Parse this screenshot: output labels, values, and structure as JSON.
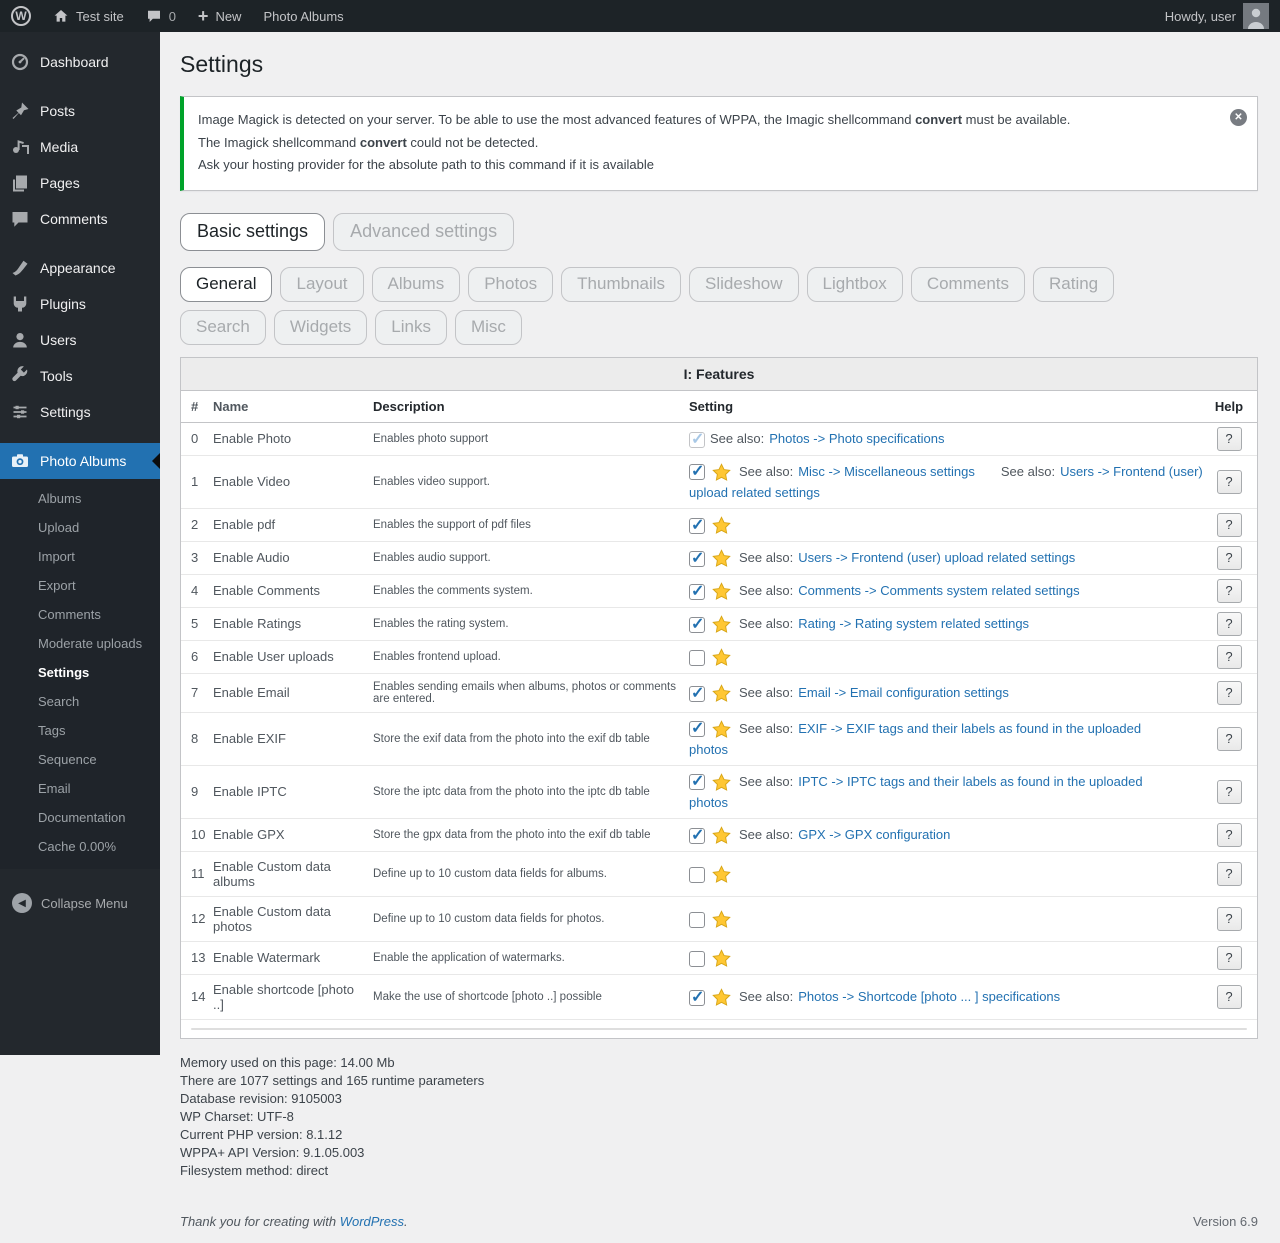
{
  "colors": {
    "accent_blue": "#2271b1",
    "notice_green": "#00a32a",
    "star_gold": "#ffc733",
    "adminbar_bg": "#1d2327",
    "sidebar_bg": "#23282d",
    "page_bg": "#f0f0f1",
    "link_blue": "#2271b1"
  },
  "admin_bar": {
    "site_name": "Test site",
    "comment_count": "0",
    "new_label": "New",
    "photo_albums_label": "Photo Albums",
    "howdy": "Howdy, user"
  },
  "sidebar": {
    "items": [
      {
        "label": "Dashboard",
        "icon": "dashboard-icon"
      },
      {
        "label": "Posts",
        "icon": "pushpin-icon",
        "gap": true
      },
      {
        "label": "Media",
        "icon": "media-icon"
      },
      {
        "label": "Pages",
        "icon": "pages-icon"
      },
      {
        "label": "Comments",
        "icon": "comment-bubble-icon"
      },
      {
        "label": "Appearance",
        "icon": "brush-icon",
        "gap": true
      },
      {
        "label": "Plugins",
        "icon": "plugin-icon"
      },
      {
        "label": "Users",
        "icon": "user-icon"
      },
      {
        "label": "Tools",
        "icon": "wrench-icon"
      },
      {
        "label": "Settings",
        "icon": "sliders-icon"
      },
      {
        "label": "Photo Albums",
        "icon": "camera-icon",
        "active": true,
        "gap": true
      }
    ],
    "submenu": [
      {
        "label": "Albums"
      },
      {
        "label": "Upload"
      },
      {
        "label": "Import"
      },
      {
        "label": "Export"
      },
      {
        "label": "Comments"
      },
      {
        "label": "Moderate uploads"
      },
      {
        "label": "Settings",
        "active": true
      },
      {
        "label": "Search"
      },
      {
        "label": "Tags"
      },
      {
        "label": "Sequence"
      },
      {
        "label": "Email"
      },
      {
        "label": "Documentation"
      },
      {
        "label": "Cache 0.00%"
      }
    ],
    "collapse_label": "Collapse Menu"
  },
  "page": {
    "title": "Settings",
    "notice": {
      "line1_pre": "Image Magick is detected on your server. To be able to use the most advanced features of WPPA, the Imagic shellcommand ",
      "line1_bold": "convert",
      "line1_post": " must be available.",
      "line2_pre": "The Imagick shellcommand ",
      "line2_bold": "convert",
      "line2_post": " could not be detected.",
      "line3": "Ask your hosting provider for the absolute path to this command if it is available"
    },
    "primary_tabs": [
      {
        "label": "Basic settings",
        "active": true
      },
      {
        "label": "Advanced settings"
      }
    ],
    "section_tabs": [
      {
        "label": "General",
        "active": true
      },
      {
        "label": "Layout"
      },
      {
        "label": "Albums"
      },
      {
        "label": "Photos"
      },
      {
        "label": "Thumbnails"
      },
      {
        "label": "Slideshow"
      },
      {
        "label": "Lightbox"
      },
      {
        "label": "Comments"
      },
      {
        "label": "Rating"
      },
      {
        "label": "Search"
      },
      {
        "label": "Widgets"
      },
      {
        "label": "Links"
      },
      {
        "label": "Misc"
      }
    ]
  },
  "table": {
    "title": "I: Features",
    "columns": [
      "#",
      "Name",
      "Description",
      "Setting",
      "Help"
    ],
    "see_also_label": "See also:",
    "help_label": "?",
    "rows": [
      {
        "num": "0",
        "name": "Enable Photo",
        "desc": "Enables photo support",
        "check": "disabled",
        "star": false,
        "see_also": [
          "Photos -> Photo specifications"
        ]
      },
      {
        "num": "1",
        "name": "Enable Video",
        "desc": "Enables video support.",
        "check": "on",
        "star": true,
        "see_also": [
          "Misc -> Miscellaneous settings",
          "Users -> Frontend (user) upload related settings"
        ]
      },
      {
        "num": "2",
        "name": "Enable pdf",
        "desc": "Enables the support of pdf files",
        "check": "on",
        "star": true,
        "see_also": []
      },
      {
        "num": "3",
        "name": "Enable Audio",
        "desc": "Enables audio support.",
        "check": "on",
        "star": true,
        "see_also": [
          "Users -> Frontend (user) upload related settings"
        ]
      },
      {
        "num": "4",
        "name": "Enable Comments",
        "desc": "Enables the comments system.",
        "check": "on",
        "star": true,
        "see_also": [
          "Comments -> Comments system related settings"
        ]
      },
      {
        "num": "5",
        "name": "Enable Ratings",
        "desc": "Enables the rating system.",
        "check": "on",
        "star": true,
        "see_also": [
          "Rating -> Rating system related settings"
        ]
      },
      {
        "num": "6",
        "name": "Enable User uploads",
        "desc": "Enables frontend upload.",
        "check": "off",
        "star": true,
        "see_also": []
      },
      {
        "num": "7",
        "name": "Enable Email",
        "desc": "Enables sending emails when albums, photos or comments are entered.",
        "check": "on",
        "star": true,
        "see_also": [
          "Email -> Email configuration settings"
        ]
      },
      {
        "num": "8",
        "name": "Enable EXIF",
        "desc": "Store the exif data from the photo into the exif db table",
        "check": "on",
        "star": true,
        "see_also": [
          "EXIF -> EXIF tags and their labels as found in the uploaded photos"
        ]
      },
      {
        "num": "9",
        "name": "Enable IPTC",
        "desc": "Store the iptc data from the photo into the iptc db table",
        "check": "on",
        "star": true,
        "see_also": [
          "IPTC -> IPTC tags and their labels as found in the uploaded photos"
        ]
      },
      {
        "num": "10",
        "name": "Enable GPX",
        "desc": "Store the gpx data from the photo into the exif db table",
        "check": "on",
        "star": true,
        "see_also": [
          "GPX -> GPX configuration"
        ]
      },
      {
        "num": "11",
        "name": "Enable Custom data albums",
        "desc": "Define up to 10 custom data fields for albums.",
        "check": "off",
        "star": true,
        "see_also": []
      },
      {
        "num": "12",
        "name": "Enable Custom data photos",
        "desc": "Define up to 10 custom data fields for photos.",
        "check": "off",
        "star": true,
        "see_also": []
      },
      {
        "num": "13",
        "name": "Enable Watermark",
        "desc": "Enable the application of watermarks.",
        "check": "off",
        "star": true,
        "see_also": []
      },
      {
        "num": "14",
        "name": "Enable shortcode [photo ..]",
        "desc": "Make the use of shortcode [photo ..] possible",
        "check": "on",
        "star": true,
        "see_also": [
          "Photos -> Shortcode [photo ... ] specifications"
        ]
      }
    ]
  },
  "info": {
    "lines": [
      "Memory used on this page: 14.00 Mb",
      "There are 1077 settings and 165 runtime parameters",
      "Database revision: 9105003",
      "WP Charset: UTF-8",
      "Current PHP version: 8.1.12",
      "WPPA+ API Version: 9.1.05.003",
      "Filesystem method: direct"
    ]
  },
  "footer": {
    "thanks_pre": "Thank you for creating with ",
    "thanks_link": "WordPress",
    "thanks_post": ".",
    "version": "Version 6.9"
  }
}
